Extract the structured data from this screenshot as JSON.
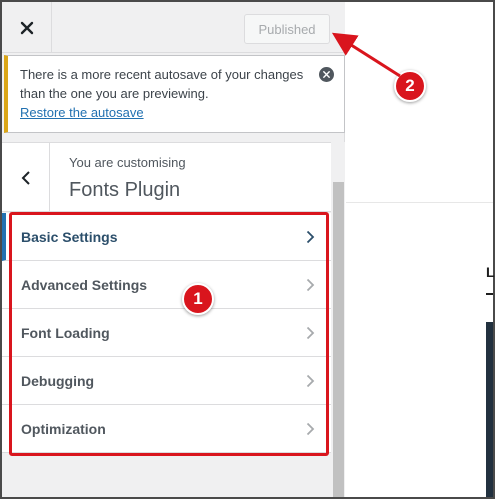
{
  "topbar": {
    "close_icon": "close-icon",
    "publish_label": "Published"
  },
  "notice": {
    "message": "There is a more recent autosave of your changes than the one you are previewing.",
    "restore_link": "Restore the autosave",
    "dismiss_icon": "dismiss-circle-icon"
  },
  "section": {
    "back_icon": "chevron-left-icon",
    "customising_label": "You are customising",
    "title": "Fonts Plugin"
  },
  "menu": {
    "items": [
      {
        "label": "Basic Settings",
        "active": true
      },
      {
        "label": "Advanced Settings",
        "active": false
      },
      {
        "label": "Font Loading",
        "active": false
      },
      {
        "label": "Debugging",
        "active": false
      },
      {
        "label": "Optimization",
        "active": false
      }
    ]
  },
  "preview": {
    "letter": "L"
  },
  "annotations": {
    "badge_1": "1",
    "badge_2": "2",
    "color": "#d9151d"
  },
  "colors": {
    "accent": "#2271b1",
    "notice_warning": "#dba617",
    "panel_bg": "#f0f0f1"
  }
}
